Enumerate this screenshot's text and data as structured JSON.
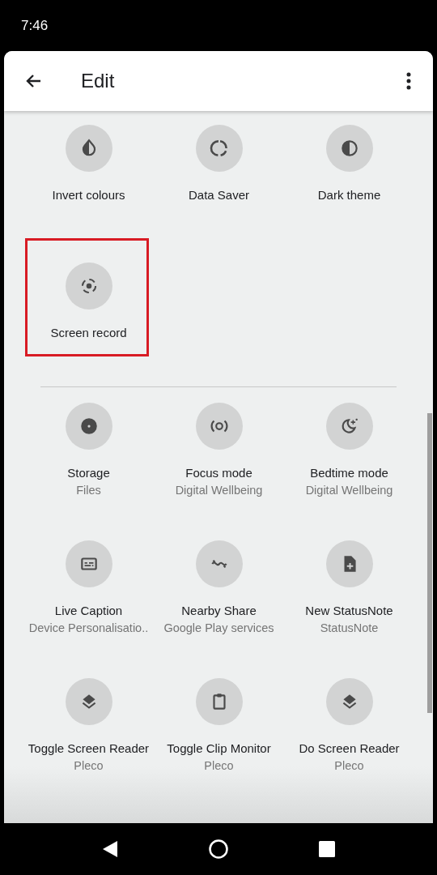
{
  "status_bar": {
    "time": "7:46"
  },
  "app_bar": {
    "title": "Edit"
  },
  "active_tiles": [
    {
      "kind": "invert",
      "label": "Invert colours",
      "highlighted": false
    },
    {
      "kind": "data_saver",
      "label": "Data Saver",
      "highlighted": false
    },
    {
      "kind": "dark_theme",
      "label": "Dark theme",
      "highlighted": false
    },
    {
      "kind": "screen_record",
      "label": "Screen record",
      "highlighted": true
    }
  ],
  "available_tiles": [
    {
      "kind": "storage",
      "label": "Storage",
      "app": "Files"
    },
    {
      "kind": "focus",
      "label": "Focus mode",
      "app": "Digital Wellbeing"
    },
    {
      "kind": "bedtime",
      "label": "Bedtime mode",
      "app": "Digital Wellbeing"
    },
    {
      "kind": "caption",
      "label": "Live Caption",
      "app": "Device Personalisatio.."
    },
    {
      "kind": "nearby",
      "label": "Nearby Share",
      "app": "Google Play services"
    },
    {
      "kind": "note",
      "label": "New StatusNote",
      "app": "StatusNote"
    },
    {
      "kind": "layers",
      "label": "Toggle Screen Reader",
      "app": "Pleco"
    },
    {
      "kind": "clipboard",
      "label": "Toggle Clip Monitor",
      "app": "Pleco"
    },
    {
      "kind": "layers",
      "label": "Do Screen Reader",
      "app": "Pleco"
    }
  ]
}
